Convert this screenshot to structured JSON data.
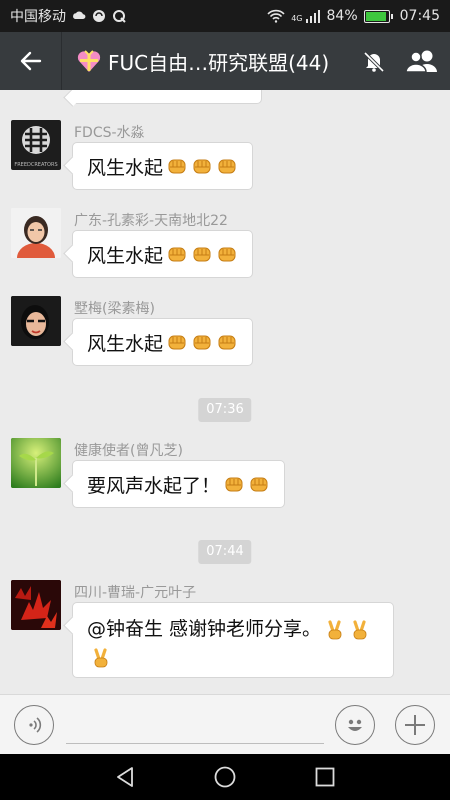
{
  "status_bar": {
    "carrier": "中国移动",
    "network": "4G",
    "battery": "84%",
    "battery_level": 0.84,
    "time": "07:45"
  },
  "header": {
    "title": "FUC自由…研究联盟(44)"
  },
  "messages": [
    {
      "sender": "FDCS-水淼",
      "text": "风生水起",
      "emoji": "fist-emoji",
      "emoji_count": 3
    },
    {
      "sender": "广东-孔素彩-天南地北22",
      "text": "风生水起",
      "emoji": "fist-emoji",
      "emoji_count": 3
    },
    {
      "sender": "墅梅(梁素梅)",
      "text": "风生水起",
      "emoji": "fist-emoji",
      "emoji_count": 3
    },
    {
      "sender": "健康使者(曾凡芝)",
      "text": "要风声水起了！",
      "emoji": "fist-emoji",
      "emoji_count": 2
    },
    {
      "sender": "四川-曹瑞-广元叶子",
      "text": "@钟奋生 感谢钟老师分享。",
      "emoji": "victory-hand-emoji",
      "emoji_count": 3
    }
  ],
  "timestamps": [
    "07:36",
    "07:44"
  ],
  "avatar_texts": {
    "fdcs_logo_text": "FREEDCREATORS"
  },
  "colors": {
    "header_bg": "#373b3e",
    "chat_bg": "#ebebeb",
    "bubble_bg": "#ffffff",
    "emoji_skin": "#f2b13b"
  }
}
